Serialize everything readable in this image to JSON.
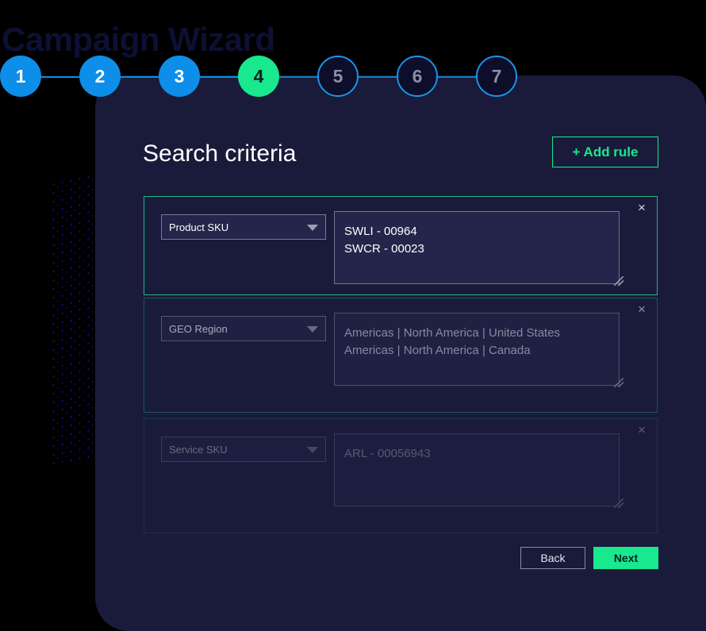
{
  "page": {
    "title": "Campaign Wizard"
  },
  "stepper": {
    "steps": [
      {
        "label": "1",
        "state": "done"
      },
      {
        "label": "2",
        "state": "done"
      },
      {
        "label": "3",
        "state": "done"
      },
      {
        "label": "4",
        "state": "current"
      },
      {
        "label": "5",
        "state": "upcoming"
      },
      {
        "label": "6",
        "state": "upcoming"
      },
      {
        "label": "7",
        "state": "upcoming"
      }
    ]
  },
  "panel": {
    "section_title": "Search criteria",
    "add_rule_label": "+ Add rule",
    "close_icon": "×"
  },
  "rules": [
    {
      "field_label": "Product SKU",
      "values_text": "SWLI - 00964\nSWCR - 00023",
      "placeholder": ""
    },
    {
      "field_label": "GEO Region",
      "values_text": "Americas | North America | United States\nAmericas | North America | Canada",
      "placeholder": ""
    },
    {
      "field_label": "Service SKU",
      "values_text": "ARL - 00056943",
      "placeholder": ""
    }
  ],
  "footer": {
    "back_label": "Back",
    "next_label": "Next"
  },
  "colors": {
    "accent_green": "#18e88e",
    "accent_blue": "#0d8ee8",
    "panel_bg": "#1a1b3a",
    "page_bg": "#000000"
  }
}
